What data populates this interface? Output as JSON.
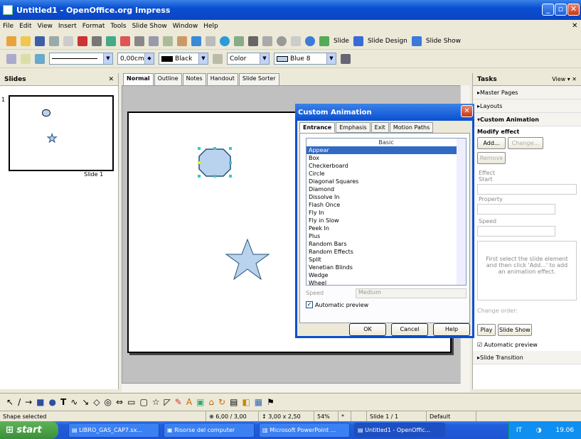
{
  "window": {
    "title": "Untitled1 - OpenOffice.org Impress"
  },
  "menu": [
    "File",
    "Edit",
    "View",
    "Insert",
    "Format",
    "Tools",
    "Slide Show",
    "Window",
    "Help"
  ],
  "toolbar1": {
    "slide_label": "Slide",
    "slide_design_label": "Slide Design",
    "slide_show_label": "Slide Show"
  },
  "toolbar2": {
    "line_width": "0,00cm",
    "line_color": "Black",
    "area_style": "Color",
    "area_color": "Blue 8"
  },
  "slides_panel": {
    "title": "Slides",
    "slide_number": "1",
    "slide_label": "Slide 1"
  },
  "view_tabs": [
    "Normal",
    "Outline",
    "Notes",
    "Handout",
    "Slide Sorter"
  ],
  "dialog": {
    "title": "Custom Animation",
    "tabs": [
      "Entrance",
      "Emphasis",
      "Exit",
      "Motion Paths"
    ],
    "list_header": "Basic",
    "effects": [
      "Appear",
      "Box",
      "Checkerboard",
      "Circle",
      "Diagonal Squares",
      "Diamond",
      "Dissolve In",
      "Flash Once",
      "Fly In",
      "Fly in Slow",
      "Peek In",
      "Plus",
      "Random Bars",
      "Random Effects",
      "Split",
      "Venetian Blinds",
      "Wedge",
      "Wheel"
    ],
    "selected": "Appear",
    "speed_label": "Speed",
    "speed_value": "Medium",
    "auto_preview": "Automatic preview",
    "ok": "OK",
    "cancel": "Cancel",
    "help": "Help"
  },
  "tasks": {
    "title": "Tasks",
    "view_label": "View",
    "master_pages": "Master Pages",
    "layouts": "Layouts",
    "custom_animation": "Custom Animation",
    "modify_effect": "Modify effect",
    "add": "Add...",
    "change": "Change...",
    "remove": "Remove",
    "effect": "Effect",
    "start": "Start",
    "property": "Property",
    "speed": "Speed",
    "hint": "First select the slide element and then click 'Add...' to add an animation effect.",
    "change_order": "Change order:",
    "play": "Play",
    "slide_show": "Slide Show",
    "auto_preview": "Automatic preview",
    "slide_transition": "Slide Transition"
  },
  "status": {
    "info": "Shape selected",
    "position": "6,00 / 3,00",
    "size": "3,00 x 2,50",
    "zoom": "54%",
    "modified": "*",
    "slide": "Slide 1 / 1",
    "layout": "Default"
  },
  "taskbar": {
    "start": "start",
    "items": [
      "LIBRO_GAS_CAP7.sx...",
      "Risorse del computer",
      "Microsoft PowerPoint ...",
      "Untitled1 - OpenOffic..."
    ],
    "lang": "IT",
    "time": "19.06"
  }
}
